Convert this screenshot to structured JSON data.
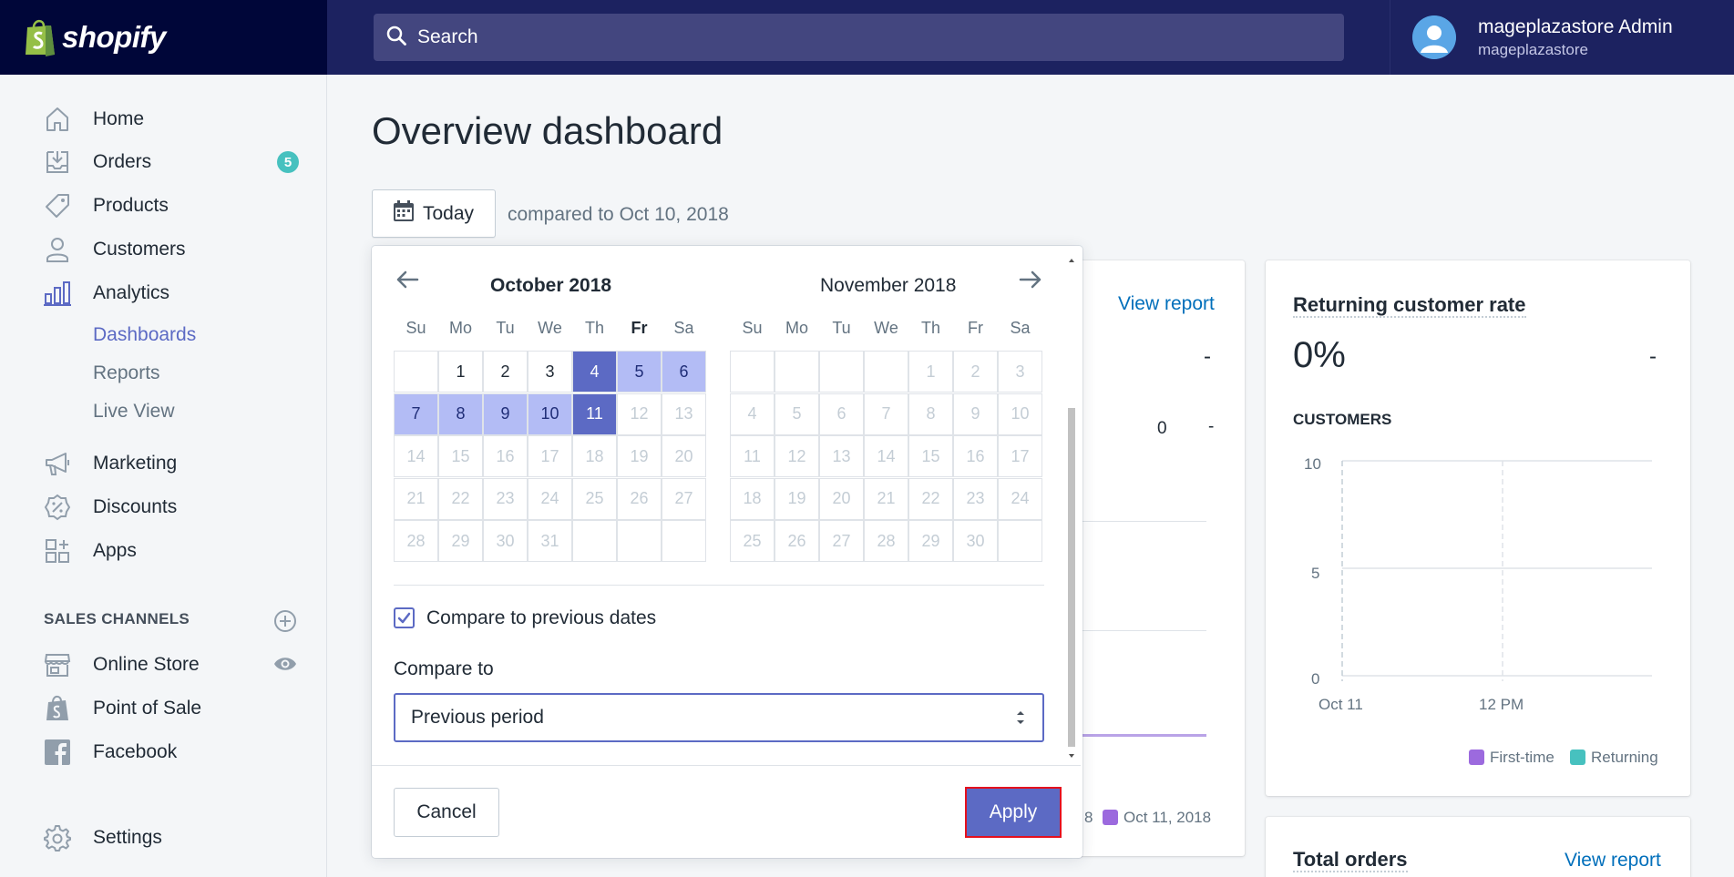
{
  "brand": {
    "name": "shopify"
  },
  "search": {
    "placeholder": "Search"
  },
  "user": {
    "name": "mageplazastore Admin",
    "store": "mageplazastore"
  },
  "sidebar": {
    "items": [
      {
        "label": "Home",
        "icon": "home-icon"
      },
      {
        "label": "Orders",
        "icon": "orders-icon",
        "badge": "5"
      },
      {
        "label": "Products",
        "icon": "tag-icon"
      },
      {
        "label": "Customers",
        "icon": "person-icon"
      },
      {
        "label": "Analytics",
        "icon": "bar-chart-icon"
      },
      {
        "label": "Marketing",
        "icon": "megaphone-icon"
      },
      {
        "label": "Discounts",
        "icon": "discount-icon"
      },
      {
        "label": "Apps",
        "icon": "apps-icon"
      }
    ],
    "analytics_sub": [
      {
        "label": "Dashboards",
        "active": true
      },
      {
        "label": "Reports",
        "active": false
      },
      {
        "label": "Live View",
        "active": false
      }
    ],
    "sales_channels_title": "SALES CHANNELS",
    "channels": [
      {
        "label": "Online Store",
        "icon": "store-icon"
      },
      {
        "label": "Point of Sale",
        "icon": "bag-icon"
      },
      {
        "label": "Facebook",
        "icon": "facebook-icon"
      }
    ],
    "settings_label": "Settings"
  },
  "page": {
    "title": "Overview dashboard",
    "date_button": "Today",
    "compared_text": "compared to Oct 10, 2018"
  },
  "datepicker": {
    "left_month": "October 2018",
    "right_month": "November 2018",
    "weekdays": [
      "Su",
      "Mo",
      "Tu",
      "We",
      "Th",
      "Fr",
      "Sa"
    ],
    "today_weekday": "Fr",
    "october_selected_start": 4,
    "october_selected_end": 11,
    "october_last_enabled": 11,
    "compare_checkbox_label": "Compare to previous dates",
    "compare_checked": true,
    "compare_to_label": "Compare to",
    "compare_to_value": "Previous period",
    "cancel_label": "Cancel",
    "apply_label": "Apply"
  },
  "sales_card": {
    "view_report": "View report",
    "dash": "-",
    "value": "0",
    "value_dash": "-",
    "legend_tail": "8",
    "legend_label": "Oct 11, 2018"
  },
  "returning_card": {
    "title": "Returning customer rate",
    "value": "0%",
    "dash": "-",
    "subtitle": "CUSTOMERS",
    "view_report": ""
  },
  "total_orders_card": {
    "title": "Total orders",
    "view_report": "View report"
  },
  "chart_data": {
    "type": "line",
    "title": "",
    "ylabel": "",
    "xlabel": "",
    "ylim": [
      0,
      10
    ],
    "y_ticks": [
      "10",
      "5",
      "0"
    ],
    "x_ticks": [
      "Oct 11",
      "12 PM"
    ],
    "series": [
      {
        "name": "First-time",
        "color": "#9c6ade",
        "values": []
      },
      {
        "name": "Returning",
        "color": "#47c1bf",
        "values": []
      }
    ],
    "grid": true,
    "legend": "bottom-right"
  },
  "colors": {
    "accent": "#5c6ac4",
    "range": "#b3bcf5",
    "topbar": "#1c2260",
    "badge": "#47c1bf",
    "apply_outline": "#e5101d"
  }
}
